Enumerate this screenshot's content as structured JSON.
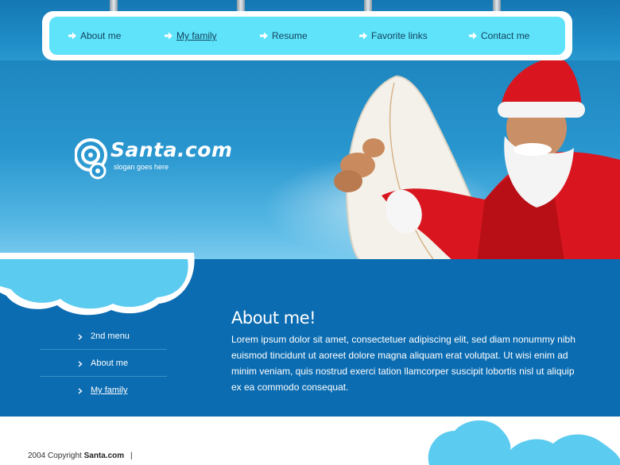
{
  "nav": {
    "items": [
      {
        "label": "About me",
        "active": false
      },
      {
        "label": "My family",
        "active": true
      },
      {
        "label": "Resume",
        "active": false
      },
      {
        "label": "Favorite links",
        "active": false
      },
      {
        "label": "Contact me",
        "active": false
      }
    ]
  },
  "logo": {
    "name": "Santa.com",
    "slogan": "slogan goes here"
  },
  "sidebar": {
    "items": [
      {
        "label": "2nd menu",
        "active": false
      },
      {
        "label": "About me",
        "active": false
      },
      {
        "label": "My family",
        "active": true
      }
    ]
  },
  "article": {
    "title": "About me!",
    "body": "Lorem ipsum dolor sit amet, consectetuer adipiscing elit, sed diam nonummy nibh euismod tincidunt ut aoreet dolore magna aliquam erat volutpat.  Ut wisi enim ad minim veniam, quis nostrud exerci tation llamcorper suscipit lobortis nisl ut aliquip ex ea commodo consequat."
  },
  "footer": {
    "copyright_prefix": "2004 Copyright",
    "brand": "Santa.com",
    "separator": "|"
  },
  "colors": {
    "nav_bar": "#5ee3fb",
    "content_band": "#0b6cb1",
    "hero_sky": "#2996cf",
    "cloud": "#5ccbf0",
    "santa_red": "#e0202a"
  },
  "icons": {
    "nav_arrow": "arrow-right-icon",
    "side_bullet": "chevron-right-icon",
    "logo_mark": "concentric-circles-logo-icon"
  }
}
